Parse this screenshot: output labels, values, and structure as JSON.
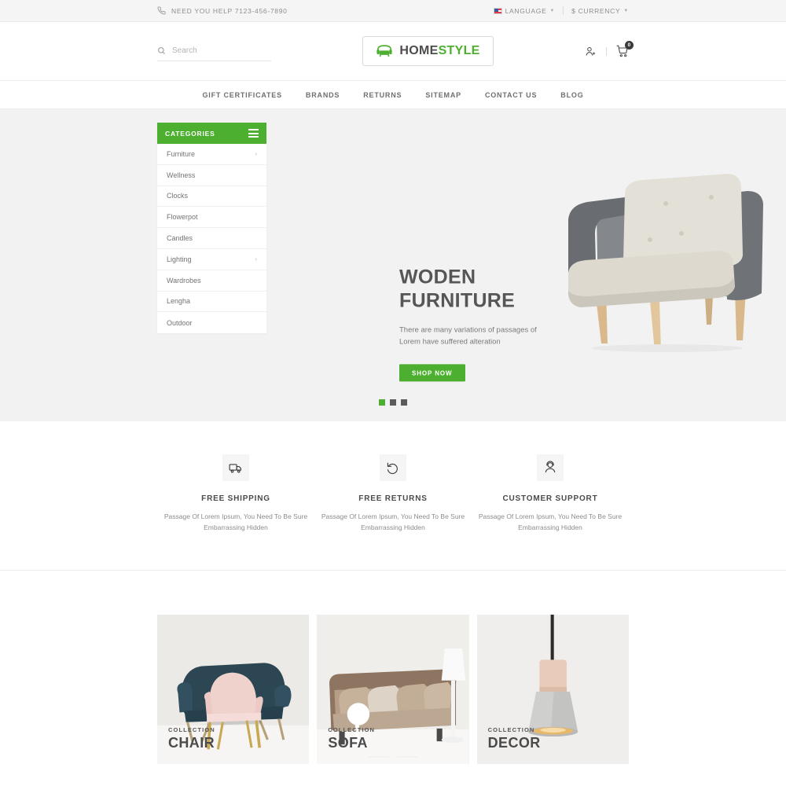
{
  "topbar": {
    "phone_icon": "phone-icon",
    "phone_text": "NEED YOU HELP 7123-456-7890",
    "language_label": "LANGUAGE",
    "currency_label": "$ CURRENCY"
  },
  "header": {
    "search_placeholder": "Search",
    "search_value": "",
    "logo_first": "HOME",
    "logo_second": "STYLE",
    "cart_count": "0"
  },
  "nav": {
    "items": [
      {
        "label": "GIFT CERTIFICATES"
      },
      {
        "label": "BRANDS"
      },
      {
        "label": "RETURNS"
      },
      {
        "label": "SITEMAP"
      },
      {
        "label": "CONTACT US"
      },
      {
        "label": "BLOG"
      }
    ]
  },
  "categories": {
    "title": "CATEGORIES",
    "items": [
      {
        "label": "Furniture",
        "has_submenu": true
      },
      {
        "label": "Wellness",
        "has_submenu": false
      },
      {
        "label": "Clocks",
        "has_submenu": false
      },
      {
        "label": "Flowerpot",
        "has_submenu": false
      },
      {
        "label": "Candles",
        "has_submenu": false
      },
      {
        "label": "Lighting",
        "has_submenu": true
      },
      {
        "label": "Wardrobes",
        "has_submenu": false
      },
      {
        "label": "Lengha",
        "has_submenu": false
      },
      {
        "label": "Outdoor",
        "has_submenu": false
      }
    ]
  },
  "hero": {
    "title_line1": "WODEN",
    "title_line2": "FURNITURE",
    "description": "There are many variations of passages of Lorem have suffered alteration",
    "button_label": "SHOP NOW",
    "slides": 3,
    "active_slide": 0
  },
  "services": [
    {
      "icon": "truck-icon",
      "title": "FREE SHIPPING",
      "description": "Passage Of Lorem Ipsum, You Need To Be Sure Embarrassing Hidden"
    },
    {
      "icon": "return-arrow-icon",
      "title": "FREE RETURNS",
      "description": "Passage Of Lorem Ipsum, You Need To Be Sure Embarrassing Hidden"
    },
    {
      "icon": "support-agent-icon",
      "title": "CUSTOMER SUPPORT",
      "description": "Passage Of Lorem Ipsum, You Need To Be Sure Embarrassing Hidden"
    }
  ],
  "collections": [
    {
      "kicker": "COLLECTION",
      "name": "CHAIR"
    },
    {
      "kicker": "COLLECTION",
      "name": "SOFA"
    },
    {
      "kicker": "COLLECTION",
      "name": "DECOR"
    }
  ],
  "colors": {
    "brand_green": "#4caf2f",
    "topbar_bg": "#f5f5f5",
    "hero_bg": "#f2f2f2",
    "text_dark": "#4a4a4a",
    "text_muted": "#8c8c8c"
  }
}
